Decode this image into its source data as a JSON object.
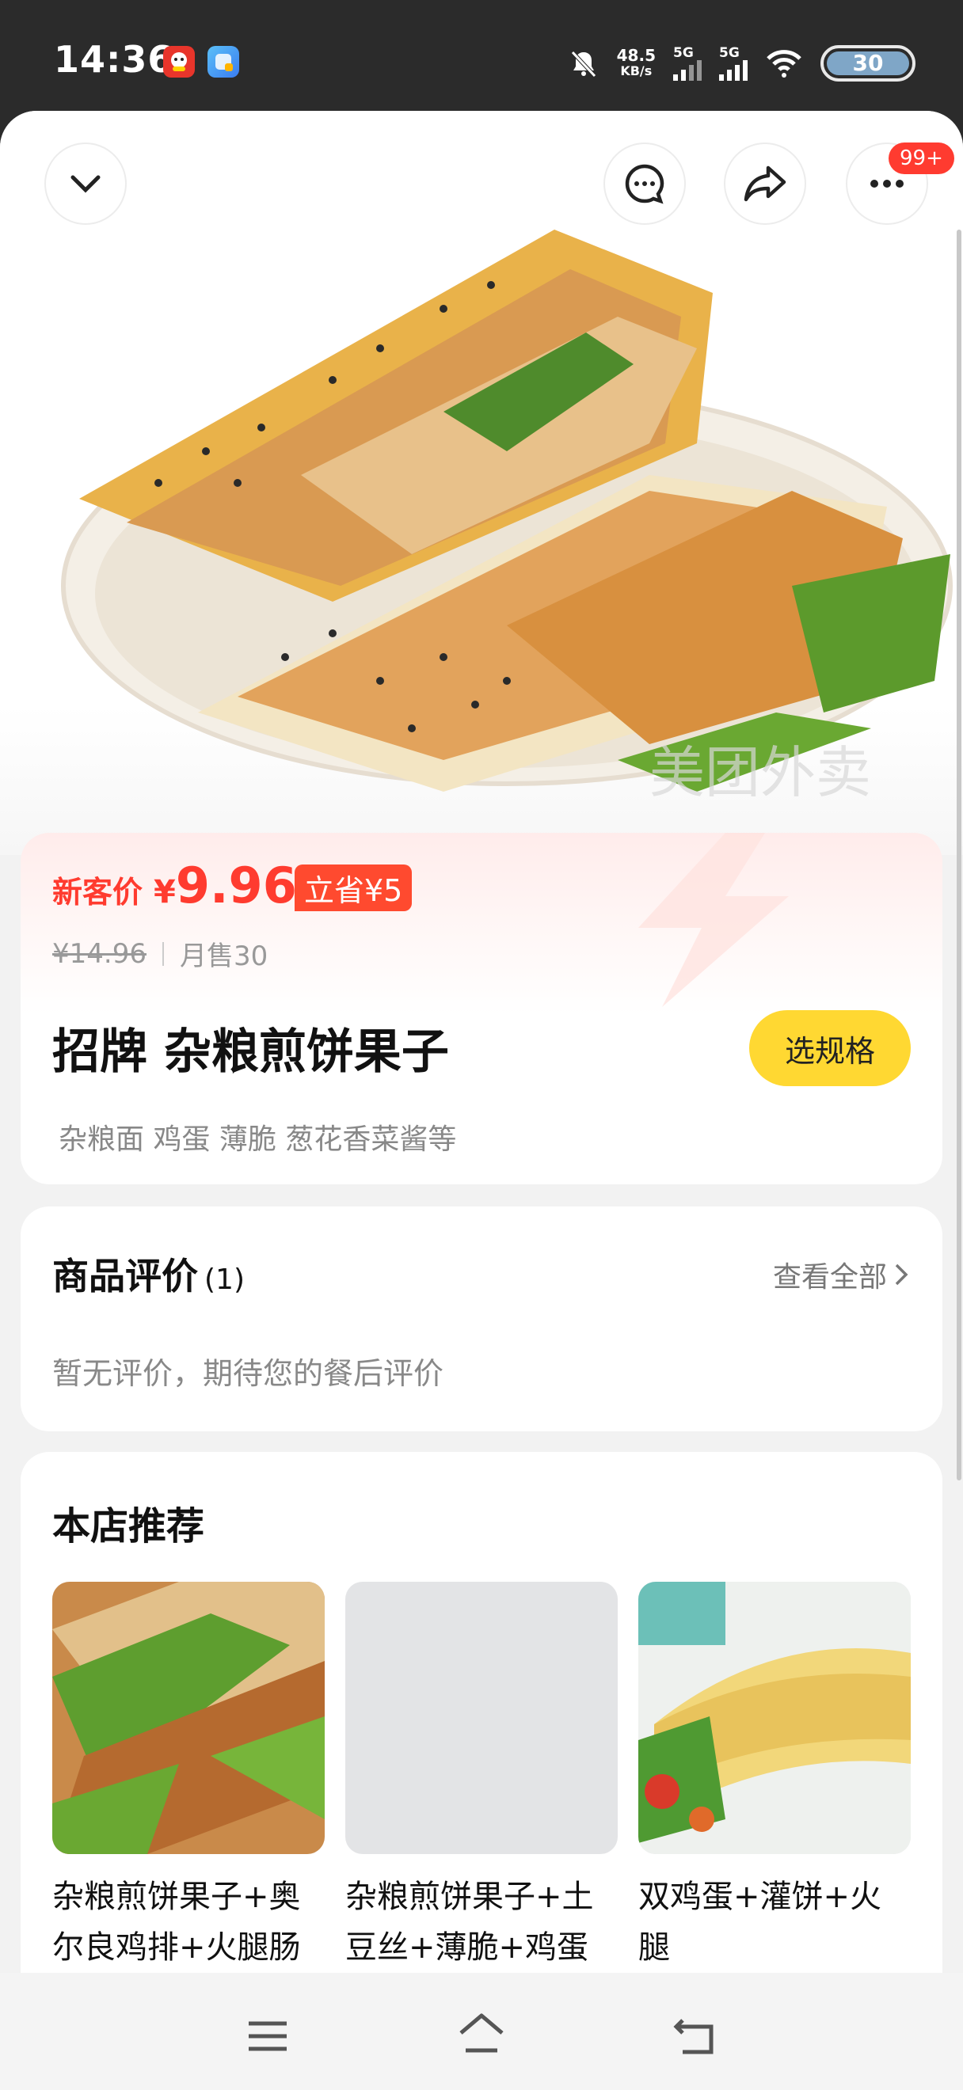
{
  "status": {
    "time": "14:36",
    "speed_top": "48.5",
    "speed_unit": "KB/s",
    "sim1": "5G",
    "sim2": "5G",
    "battery": "30"
  },
  "header": {
    "notify_badge": "99+"
  },
  "product": {
    "new_price_label": "新客价",
    "currency": "¥",
    "new_price": "9.96",
    "save_tag": "立省¥5",
    "old_price": "¥14.96",
    "monthly_sales": "月售30",
    "name": "招牌 杂粮煎饼果子",
    "choose_spec": "选规格",
    "ingredients": "杂粮面 鸡蛋 薄脆 葱花香菜酱等"
  },
  "reviews": {
    "title": "商品评价",
    "count": "(1)",
    "view_all": "查看全部",
    "empty_text": "暂无评价，期待您的餐后评价"
  },
  "recommend": {
    "title": "本店推荐",
    "items": [
      {
        "name": "杂粮煎饼果子+奥尔良鸡排+火腿肠"
      },
      {
        "name": "杂粮煎饼果子+土豆丝+薄脆+鸡蛋"
      },
      {
        "name": "双鸡蛋+灌饼+火腿"
      }
    ]
  },
  "watermark": "美团外卖",
  "colors": {
    "accent_red": "#ff3b2f",
    "spec_yellow": "#ffd832"
  }
}
